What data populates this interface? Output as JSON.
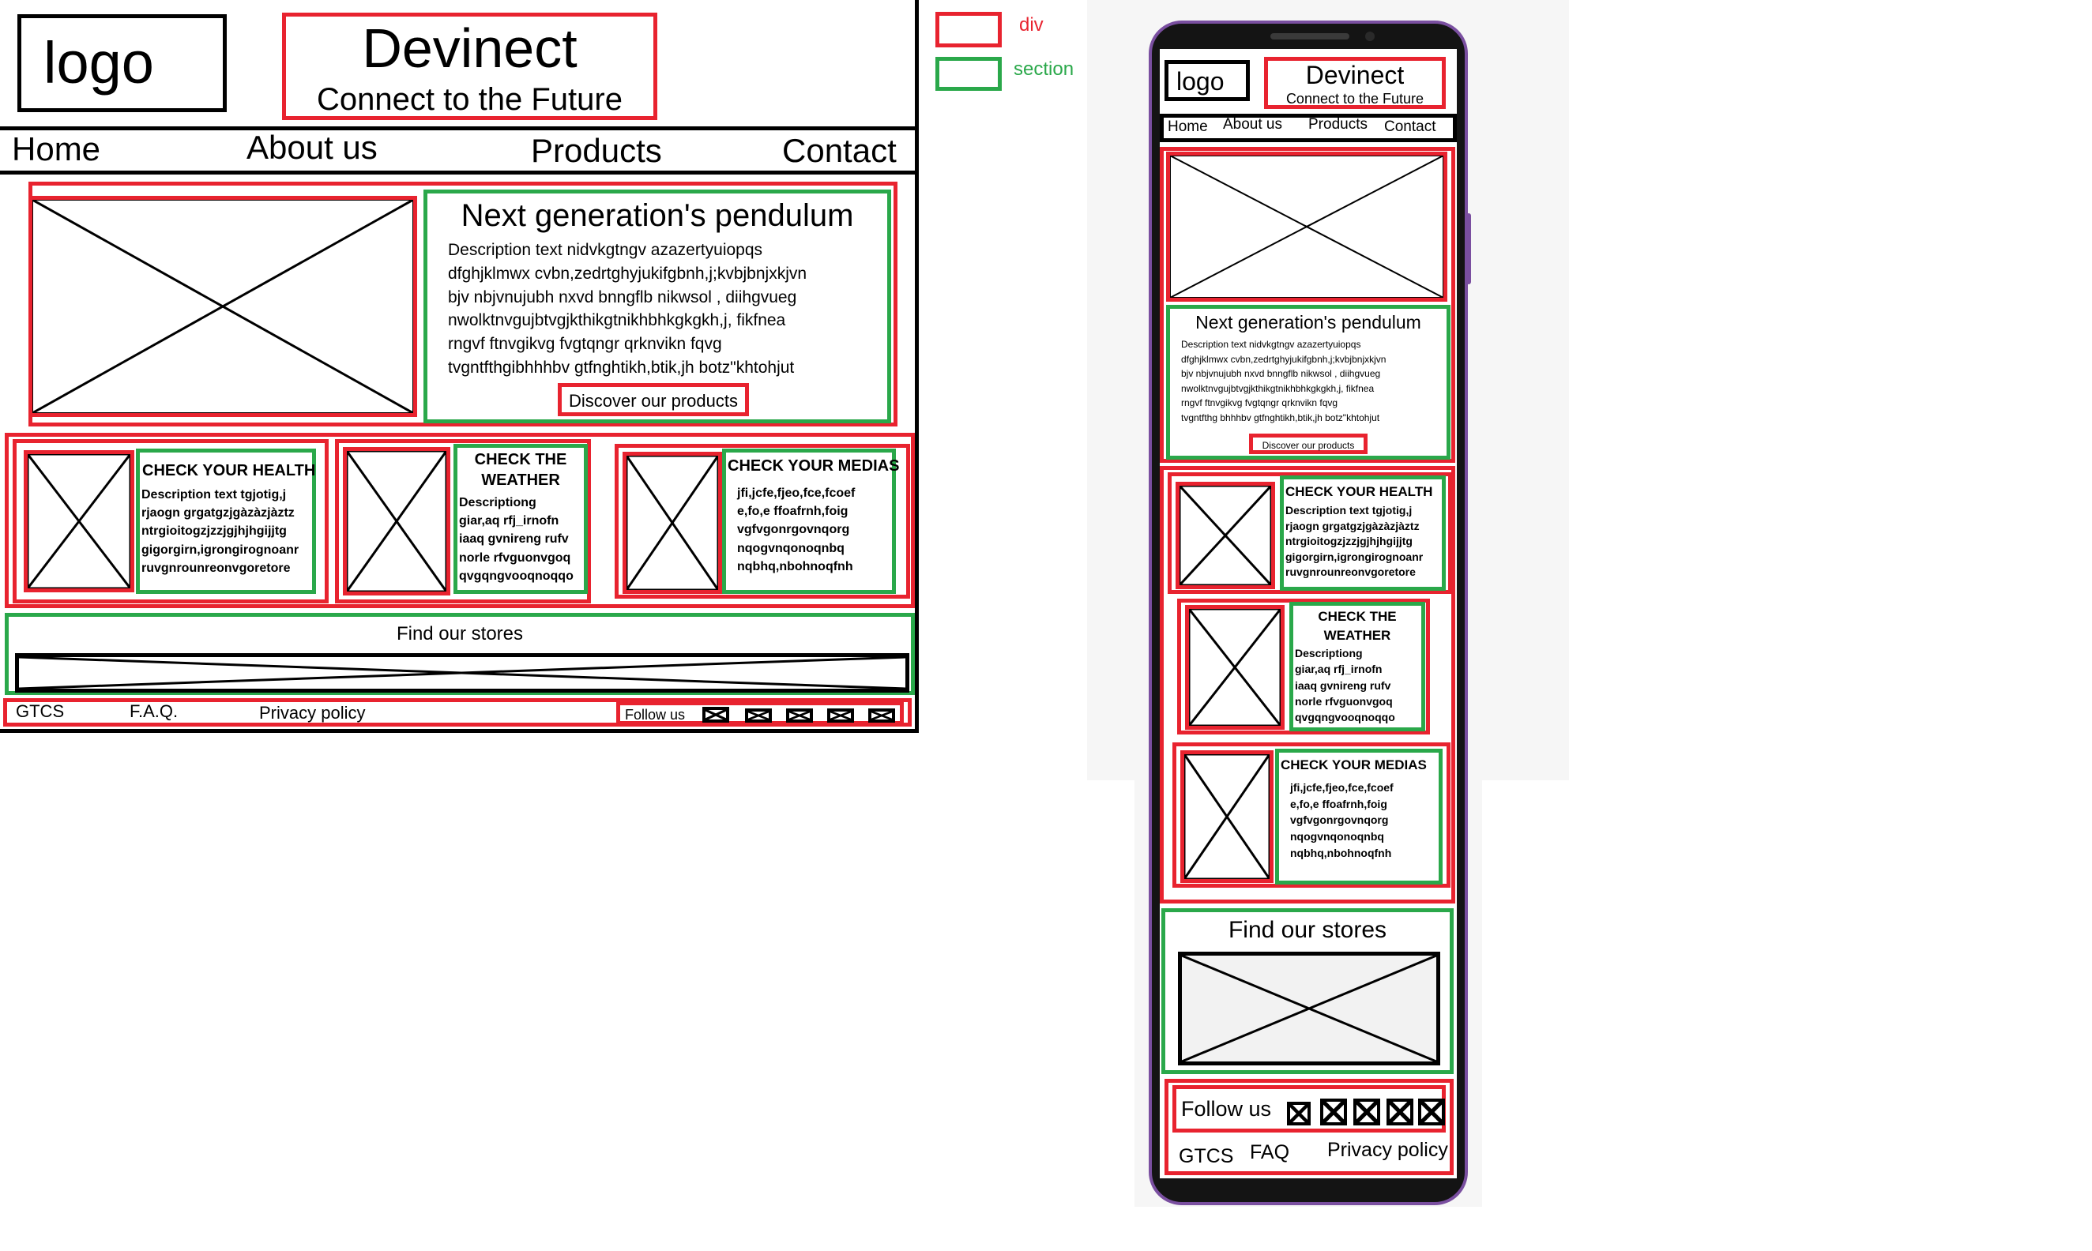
{
  "legend": {
    "div": "div",
    "section": "section",
    "div_color": "#e8232f",
    "section_color": "#2aa84a"
  },
  "desktop": {
    "logo": "logo",
    "brand": {
      "title": "Devinect",
      "tagline": "Connect to the Future"
    },
    "nav": [
      "Home",
      "About us",
      "Products",
      "Contact"
    ],
    "hero": {
      "title": "Next generation's pendulum",
      "description": "Description text nidvkgtngv azazertyuiopqs\ndfghjklmwx cvbn,zedrtghyjukifgbnh,j;kvbjbnjxkjvn\nbjv nbjvnujubh nxvd bnngflb nikwsol , diihgvueg\nnwolktnvgujbtvgjkthikgtnikhbhkgkgkh,j, fikfnea\nrngvf ftnvgikvg fvgtqngr qrknvikn fqvg\ntvgntfthgibhhhbv gtfnghtikh,btik,jh botz\"khtohjut",
      "button": "Discover our products"
    },
    "cards": [
      {
        "title": "CHECK YOUR HEALTH",
        "text": "Description text tgjotig,j\nrjaogn grgatgzjgàzàzjàztz\nntrgioitogzjzzjgjhjhgijjtg\ngigorgirn,igrongirognoanr\nruvgnrounreonvgoretore"
      },
      {
        "title": "CHECK THE\nWEATHER",
        "text": "Descriptiong\ngiar,aq rfj_irnofn\niaaq gvnireng rufv\nnorle rfvguonvgoq\nqvgqngvooqnoqqo"
      },
      {
        "title": "CHECK YOUR MEDIAS",
        "text": "jfi,jcfe,fjeo,fce,fcoef\ne,fo,e ffoafrnh,foig\nvgfvgonrgovnqorg\nnqogvnqonoqnbq\nnqbhq,nbohnoqfnh"
      }
    ],
    "stores": "Find our stores",
    "footer": {
      "links": [
        "GTCS",
        "F.A.Q.",
        "Privacy policy"
      ],
      "follow": "Follow us"
    }
  },
  "mobile": {
    "logo": "logo",
    "brand": {
      "title": "Devinect",
      "tagline": "Connect to the Future"
    },
    "nav": [
      "Home",
      "About us",
      "Products",
      "Contact"
    ],
    "hero": {
      "title": "Next generation's pendulum",
      "description": "Description text nidvkgtngv azazertyuiopqs\ndfghjklmwx cvbn,zedrtghyjukifgbnh,j;kvbjbnjxkjvn\nbjv nbjvnujubh nxvd bnngflb nikwsol , diihgvueg\nnwolktnvgujbtvgjkthikgtnikhbhkgkgkh,j, fikfnea\nrngvf ftnvgikvg fvgtqngr qrknvikn fqvg\ntvgntfthg bhhhbv gtfnghtikh,btik,jh botz\"khtohjut",
      "button": "Discover our products"
    },
    "cards": [
      {
        "title": "CHECK YOUR HEALTH",
        "text": "Description text tgjotig,j\nrjaogn grgatgzjgàzàzjàztz\nntrgioitogzjzzjgjhjhgijjtg\ngigorgirn,igrongirognoanr\nruvgnrounreonvgoretore"
      },
      {
        "title": "CHECK THE\nWEATHER",
        "text": "Descriptiong\ngiar,aq rfj_irnofn\niaaq gvnireng rufv\nnorle rfvguonvgoq\nqvgqngvooqnoqqo"
      },
      {
        "title": "CHECK YOUR MEDIAS",
        "text": "jfi,jcfe,fjeo,fce,fcoef\ne,fo,e ffoafrnh,foig\nvgfvgonrgovnqorg\nnqogvnqonoqnbq\nnqbhq,nbohnoqfnh"
      }
    ],
    "stores": "Find our stores",
    "follow": "Follow us",
    "footer": {
      "links": [
        "GTCS",
        "FAQ",
        "Privacy policy"
      ]
    }
  }
}
